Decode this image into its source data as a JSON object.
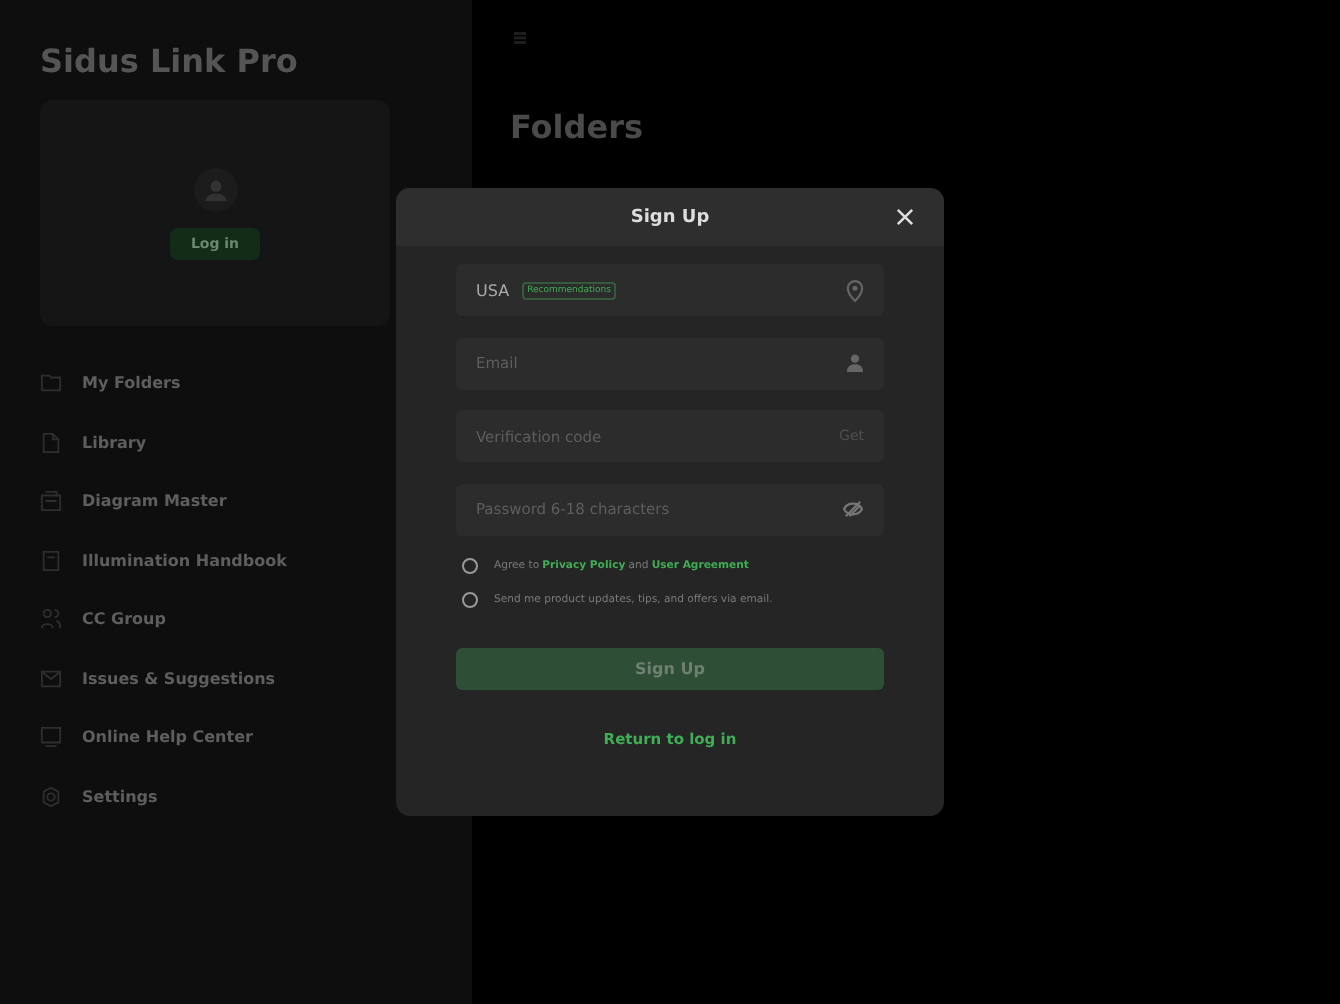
{
  "sidebar": {
    "app_title": "Sidus Link Pro",
    "login_button": "Log in",
    "items": [
      {
        "label": "My Folders"
      },
      {
        "label": "Library"
      },
      {
        "label": "Diagram Master"
      },
      {
        "label": "Illumination Handbook"
      },
      {
        "label": "CC Group"
      },
      {
        "label": "Issues & Suggestions"
      },
      {
        "label": "Online Help Center"
      },
      {
        "label": "Settings"
      }
    ]
  },
  "main": {
    "heading": "Folders"
  },
  "dialog": {
    "title": "Sign Up",
    "fields": [
      {
        "kind": "region",
        "value": "USA",
        "badge": "Recommendations"
      },
      {
        "kind": "email",
        "placeholder": "Email"
      },
      {
        "kind": "code",
        "placeholder": "Verification code",
        "action": "Get"
      },
      {
        "kind": "password",
        "placeholder": "Password 6-18 characters"
      }
    ],
    "options": [
      {
        "segments": [
          {
            "text": "Agree to",
            "link": false
          },
          {
            "text": "Privacy Policy",
            "link": true
          },
          {
            "text": "and",
            "link": false
          },
          {
            "text": "User Agreement",
            "link": true
          }
        ],
        "selected": false
      },
      {
        "segments": [
          {
            "text": "Send me product updates, tips, and offers via email.",
            "link": false
          }
        ],
        "selected": false
      }
    ],
    "submit": "Sign Up",
    "return_link": "Return to log in"
  }
}
